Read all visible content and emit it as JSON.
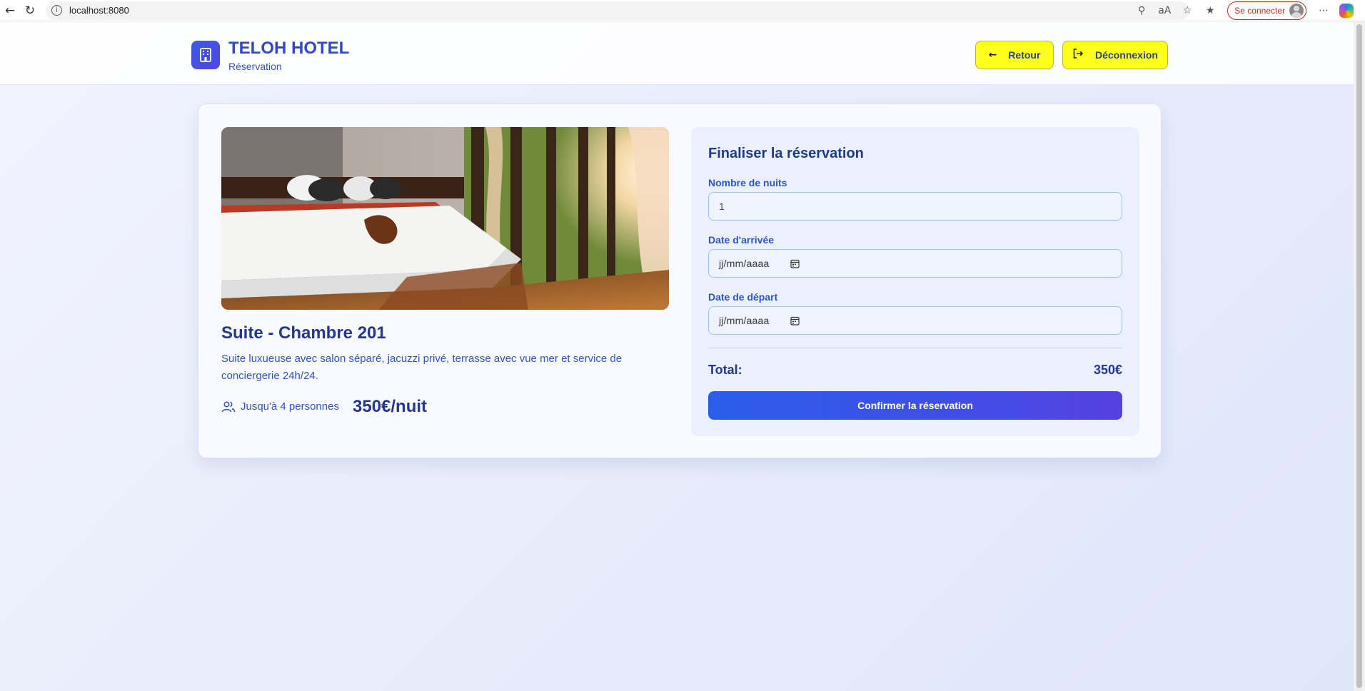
{
  "browser": {
    "url": "localhost:8080",
    "signin_label": "Se connecter"
  },
  "header": {
    "brand": "TELOH HOTEL",
    "subtitle": "Réservation",
    "back_label": "Retour",
    "logout_label": "Déconnexion"
  },
  "room": {
    "title": "Suite - Chambre 201",
    "description": "Suite luxueuse avec salon séparé, jacuzzi privé, terrasse avec vue mer et service de conciergerie 24h/24.",
    "capacity": "Jusqu'à 4 personnes",
    "price": "350€/nuit"
  },
  "booking": {
    "title": "Finaliser la réservation",
    "nights_label": "Nombre de nuits",
    "nights_value": "1",
    "arrival_label": "Date d'arrivée",
    "arrival_placeholder": "jj/mm/aaaa",
    "departure_label": "Date de départ",
    "departure_placeholder": "jj/mm/aaaa",
    "total_label": "Total:",
    "total_value": "350€",
    "confirm_label": "Confirmer la réservation"
  },
  "colors": {
    "accent_yellow": "#ffff1e",
    "brand_blue": "#3447c7",
    "confirm_start": "#2b5ee8",
    "confirm_end": "#5640e0"
  }
}
